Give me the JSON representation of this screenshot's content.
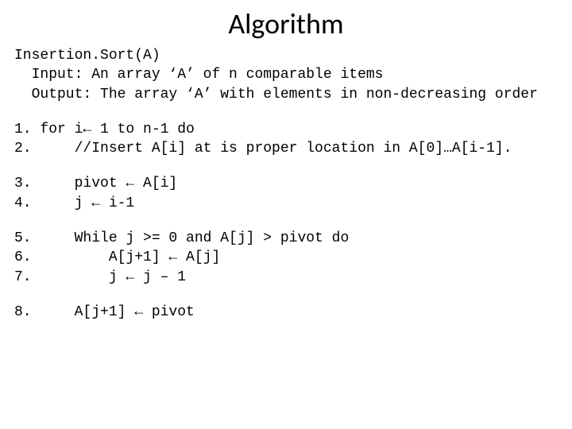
{
  "slide": {
    "title": "Algorithm",
    "header": {
      "l1": "Insertion.Sort(A)",
      "l2": "  Input: An array ‘A’ of n comparable items",
      "l3": "  Output: The array ‘A’ with elements in non-decreasing order"
    },
    "g1": {
      "l1": "1. for i← 1 to n-1 do",
      "l2": "2.     //Insert A[i] at is proper location in A[0]…A[i-1]."
    },
    "g2": {
      "l1": "3.     pivot ← A[i]",
      "l2": "4.     j ← i-1"
    },
    "g3": {
      "l1": "5.     While j >= 0 and A[j] > pivot do",
      "l2": "6.         A[j+1] ← A[j]",
      "l3": "7.         j ← j – 1"
    },
    "g4": {
      "l1": "8.     A[j+1] ← pivot"
    }
  }
}
